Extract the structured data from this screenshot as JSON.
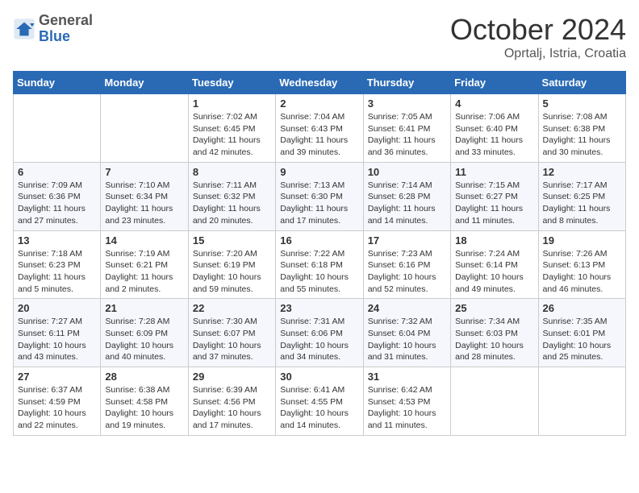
{
  "header": {
    "logo_general": "General",
    "logo_blue": "Blue",
    "month": "October 2024",
    "location": "Oprtalj, Istria, Croatia"
  },
  "days_of_week": [
    "Sunday",
    "Monday",
    "Tuesday",
    "Wednesday",
    "Thursday",
    "Friday",
    "Saturday"
  ],
  "weeks": [
    [
      null,
      null,
      {
        "day": 1,
        "sunrise": "7:02 AM",
        "sunset": "6:45 PM",
        "daylight": "11 hours and 42 minutes."
      },
      {
        "day": 2,
        "sunrise": "7:04 AM",
        "sunset": "6:43 PM",
        "daylight": "11 hours and 39 minutes."
      },
      {
        "day": 3,
        "sunrise": "7:05 AM",
        "sunset": "6:41 PM",
        "daylight": "11 hours and 36 minutes."
      },
      {
        "day": 4,
        "sunrise": "7:06 AM",
        "sunset": "6:40 PM",
        "daylight": "11 hours and 33 minutes."
      },
      {
        "day": 5,
        "sunrise": "7:08 AM",
        "sunset": "6:38 PM",
        "daylight": "11 hours and 30 minutes."
      }
    ],
    [
      {
        "day": 6,
        "sunrise": "7:09 AM",
        "sunset": "6:36 PM",
        "daylight": "11 hours and 27 minutes."
      },
      {
        "day": 7,
        "sunrise": "7:10 AM",
        "sunset": "6:34 PM",
        "daylight": "11 hours and 23 minutes."
      },
      {
        "day": 8,
        "sunrise": "7:11 AM",
        "sunset": "6:32 PM",
        "daylight": "11 hours and 20 minutes."
      },
      {
        "day": 9,
        "sunrise": "7:13 AM",
        "sunset": "6:30 PM",
        "daylight": "11 hours and 17 minutes."
      },
      {
        "day": 10,
        "sunrise": "7:14 AM",
        "sunset": "6:28 PM",
        "daylight": "11 hours and 14 minutes."
      },
      {
        "day": 11,
        "sunrise": "7:15 AM",
        "sunset": "6:27 PM",
        "daylight": "11 hours and 11 minutes."
      },
      {
        "day": 12,
        "sunrise": "7:17 AM",
        "sunset": "6:25 PM",
        "daylight": "11 hours and 8 minutes."
      }
    ],
    [
      {
        "day": 13,
        "sunrise": "7:18 AM",
        "sunset": "6:23 PM",
        "daylight": "11 hours and 5 minutes."
      },
      {
        "day": 14,
        "sunrise": "7:19 AM",
        "sunset": "6:21 PM",
        "daylight": "11 hours and 2 minutes."
      },
      {
        "day": 15,
        "sunrise": "7:20 AM",
        "sunset": "6:19 PM",
        "daylight": "10 hours and 59 minutes."
      },
      {
        "day": 16,
        "sunrise": "7:22 AM",
        "sunset": "6:18 PM",
        "daylight": "10 hours and 55 minutes."
      },
      {
        "day": 17,
        "sunrise": "7:23 AM",
        "sunset": "6:16 PM",
        "daylight": "10 hours and 52 minutes."
      },
      {
        "day": 18,
        "sunrise": "7:24 AM",
        "sunset": "6:14 PM",
        "daylight": "10 hours and 49 minutes."
      },
      {
        "day": 19,
        "sunrise": "7:26 AM",
        "sunset": "6:13 PM",
        "daylight": "10 hours and 46 minutes."
      }
    ],
    [
      {
        "day": 20,
        "sunrise": "7:27 AM",
        "sunset": "6:11 PM",
        "daylight": "10 hours and 43 minutes."
      },
      {
        "day": 21,
        "sunrise": "7:28 AM",
        "sunset": "6:09 PM",
        "daylight": "10 hours and 40 minutes."
      },
      {
        "day": 22,
        "sunrise": "7:30 AM",
        "sunset": "6:07 PM",
        "daylight": "10 hours and 37 minutes."
      },
      {
        "day": 23,
        "sunrise": "7:31 AM",
        "sunset": "6:06 PM",
        "daylight": "10 hours and 34 minutes."
      },
      {
        "day": 24,
        "sunrise": "7:32 AM",
        "sunset": "6:04 PM",
        "daylight": "10 hours and 31 minutes."
      },
      {
        "day": 25,
        "sunrise": "7:34 AM",
        "sunset": "6:03 PM",
        "daylight": "10 hours and 28 minutes."
      },
      {
        "day": 26,
        "sunrise": "7:35 AM",
        "sunset": "6:01 PM",
        "daylight": "10 hours and 25 minutes."
      }
    ],
    [
      {
        "day": 27,
        "sunrise": "6:37 AM",
        "sunset": "4:59 PM",
        "daylight": "10 hours and 22 minutes."
      },
      {
        "day": 28,
        "sunrise": "6:38 AM",
        "sunset": "4:58 PM",
        "daylight": "10 hours and 19 minutes."
      },
      {
        "day": 29,
        "sunrise": "6:39 AM",
        "sunset": "4:56 PM",
        "daylight": "10 hours and 17 minutes."
      },
      {
        "day": 30,
        "sunrise": "6:41 AM",
        "sunset": "4:55 PM",
        "daylight": "10 hours and 14 minutes."
      },
      {
        "day": 31,
        "sunrise": "6:42 AM",
        "sunset": "4:53 PM",
        "daylight": "10 hours and 11 minutes."
      },
      null,
      null
    ]
  ]
}
